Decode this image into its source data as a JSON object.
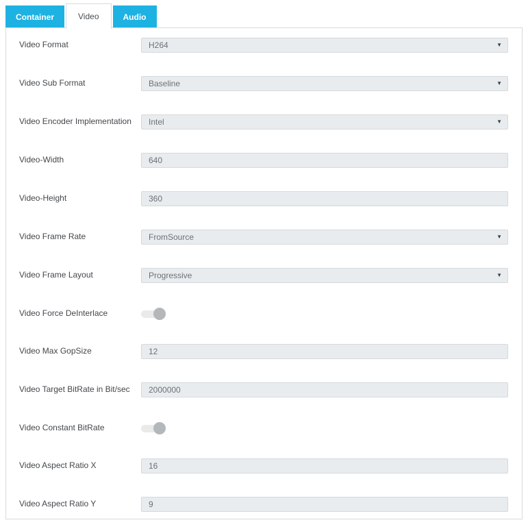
{
  "tabs": [
    {
      "label": "Container",
      "active": false
    },
    {
      "label": "Video",
      "active": true
    },
    {
      "label": "Audio",
      "active": false
    }
  ],
  "icons": {
    "dropdown_arrow": "▼"
  },
  "colors": {
    "tab_background": "#1db2e2",
    "tab_text": "#ffffff",
    "active_tab_text": "#4a4e52",
    "panel_border": "#d8dadc",
    "field_background": "#e9ecef",
    "field_border": "#d5d9dc",
    "field_text": "#6c7176",
    "label_text": "#43474b",
    "toggle_track": "#eaeaea",
    "toggle_knob": "#b5b8ba"
  },
  "form": {
    "rows": [
      {
        "label": "Video Format",
        "type": "select",
        "value": "H264"
      },
      {
        "label": "Video Sub Format",
        "type": "select",
        "value": "Baseline"
      },
      {
        "label": "Video Encoder Implementation",
        "type": "select",
        "value": "Intel"
      },
      {
        "label": "Video-Width",
        "type": "input",
        "value": "640"
      },
      {
        "label": "Video-Height",
        "type": "input",
        "value": "360"
      },
      {
        "label": "Video Frame Rate",
        "type": "select",
        "value": "FromSource"
      },
      {
        "label": "Video Frame Layout",
        "type": "select",
        "value": "Progressive"
      },
      {
        "label": "Video Force DeInterlace",
        "type": "toggle",
        "value": "off"
      },
      {
        "label": "Video Max GopSize",
        "type": "input",
        "value": "12"
      },
      {
        "label": "Video Target BitRate in Bit/sec",
        "type": "input",
        "value": "2000000"
      },
      {
        "label": "Video Constant BitRate",
        "type": "toggle",
        "value": "off"
      },
      {
        "label": "Video Aspect Ratio X",
        "type": "input",
        "value": "16"
      },
      {
        "label": "Video Aspect Ratio Y",
        "type": "input",
        "value": "9"
      }
    ]
  }
}
